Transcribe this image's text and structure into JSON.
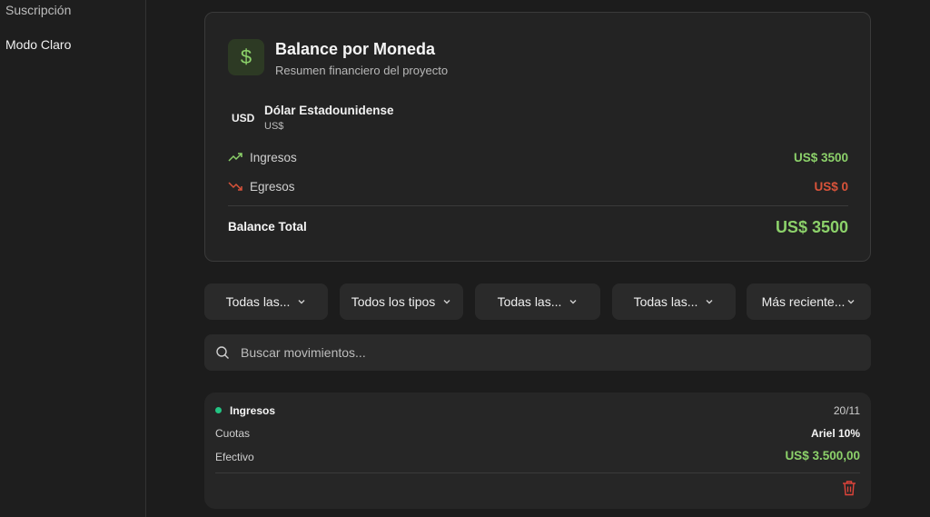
{
  "sidebar": {
    "items": [
      {
        "label": "Suscripción"
      },
      {
        "label": "Modo Claro"
      }
    ]
  },
  "balance_card": {
    "icon": "dollar-icon",
    "icon_glyph": "$",
    "title": "Balance por Moneda",
    "subtitle": "Resumen financiero del proyecto",
    "currency": {
      "code": "USD",
      "name": "Dólar Estadounidense",
      "symbol": "US$"
    },
    "income": {
      "label": "Ingresos",
      "value": "US$ 3500"
    },
    "expense": {
      "label": "Egresos",
      "value": "US$ 0"
    },
    "total": {
      "label": "Balance Total",
      "value": "US$ 3500"
    }
  },
  "filters": [
    {
      "label": "Todas las..."
    },
    {
      "label": "Todos los tipos"
    },
    {
      "label": "Todas las..."
    },
    {
      "label": "Todas las..."
    },
    {
      "label": "Más reciente..."
    }
  ],
  "search": {
    "placeholder": "Buscar movimientos..."
  },
  "movements": [
    {
      "type": "Ingresos",
      "date": "20/11",
      "category": "Cuotas",
      "person": "Ariel 10%",
      "method": "Efectivo",
      "amount": "US$ 3.500,00"
    }
  ],
  "colors": {
    "accent_green": "#8cd16a",
    "expense_red": "#d9533a",
    "status_dot": "#23c483",
    "delete_red": "#e0443a"
  }
}
